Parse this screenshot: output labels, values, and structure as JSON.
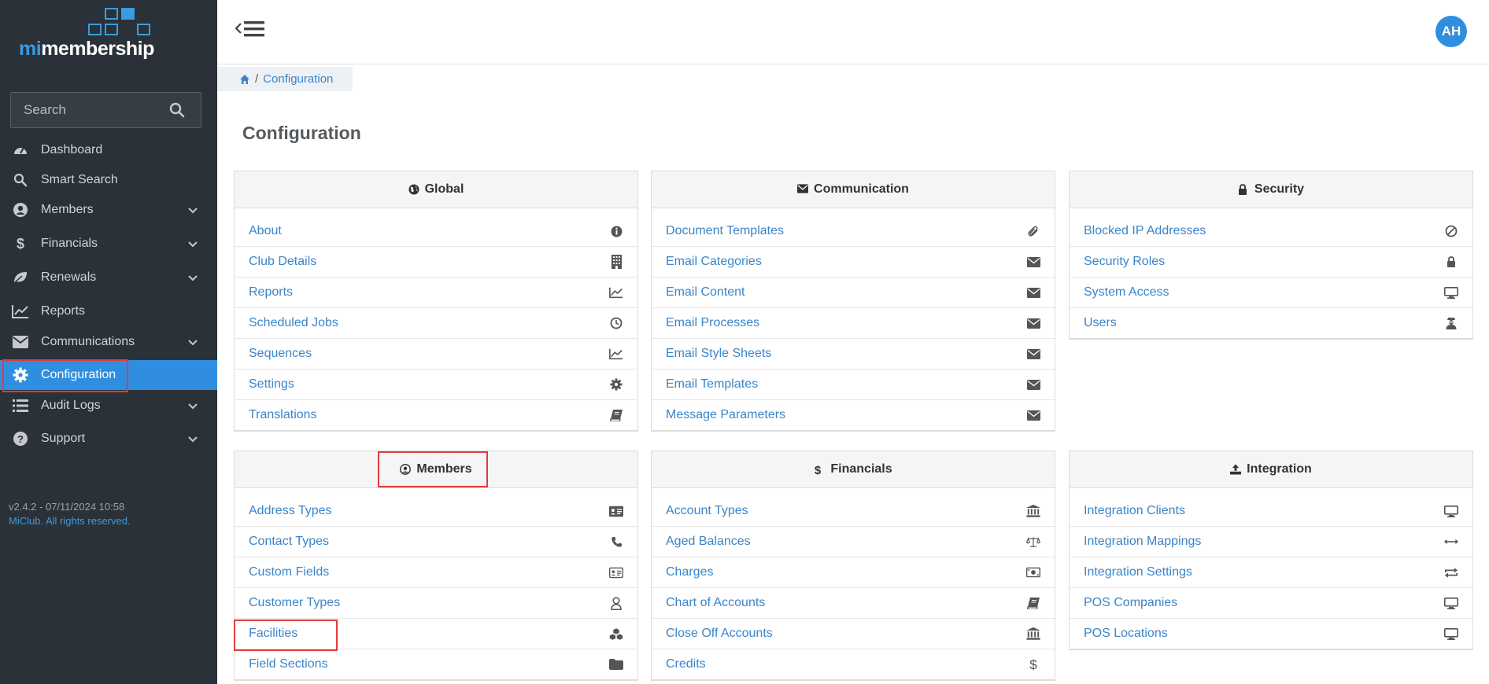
{
  "logo": {
    "prefix": "mi",
    "suffix": "membership"
  },
  "search": {
    "placeholder": "Search"
  },
  "nav": {
    "items": [
      {
        "label": "Dashboard",
        "icon": "dashboard-icon"
      },
      {
        "label": "Smart Search",
        "icon": "search-icon"
      },
      {
        "label": "Members",
        "icon": "user-circle-icon"
      },
      {
        "label": "Financials",
        "icon": "dollar-icon"
      },
      {
        "label": "Renewals",
        "icon": "leaf-icon"
      },
      {
        "label": "Reports",
        "icon": "line-chart-icon"
      },
      {
        "label": "Communications",
        "icon": "envelope-icon"
      },
      {
        "label": "Configuration",
        "icon": "gear-icon"
      },
      {
        "label": "Audit Logs",
        "icon": "list-icon"
      },
      {
        "label": "Support",
        "icon": "question-circle-icon"
      }
    ]
  },
  "footer": {
    "version": "v2.4.2 - 07/11/2024 10:58",
    "rights": "MiClub. All rights reserved."
  },
  "topbar": {
    "avatar": "AH"
  },
  "breadcrumb": {
    "separator": "/",
    "current": "Configuration"
  },
  "page": {
    "title": "Configuration"
  },
  "panels": {
    "global": {
      "title": "Global",
      "items": [
        "About",
        "Club Details",
        "Reports",
        "Scheduled Jobs",
        "Sequences",
        "Settings",
        "Translations"
      ]
    },
    "communication": {
      "title": "Communication",
      "items": [
        "Document Templates",
        "Email Categories",
        "Email Content",
        "Email Processes",
        "Email Style Sheets",
        "Email Templates",
        "Message Parameters"
      ]
    },
    "security": {
      "title": "Security",
      "items": [
        "Blocked IP Addresses",
        "Security Roles",
        "System Access",
        "Users"
      ]
    },
    "members": {
      "title": "Members",
      "items": [
        "Address Types",
        "Contact Types",
        "Custom Fields",
        "Customer Types",
        "Facilities",
        "Field Sections"
      ]
    },
    "financials": {
      "title": "Financials",
      "items": [
        "Account Types",
        "Aged Balances",
        "Charges",
        "Chart of Accounts",
        "Close Off Accounts",
        "Credits"
      ]
    },
    "integration": {
      "title": "Integration",
      "items": [
        "Integration Clients",
        "Integration Mappings",
        "Integration Settings",
        "POS Companies",
        "POS Locations"
      ]
    }
  },
  "colors": {
    "sidebar": "#2b3138",
    "accent": "#2f8ee0",
    "link": "#3a85c9",
    "highlight": "#e03b3b"
  }
}
